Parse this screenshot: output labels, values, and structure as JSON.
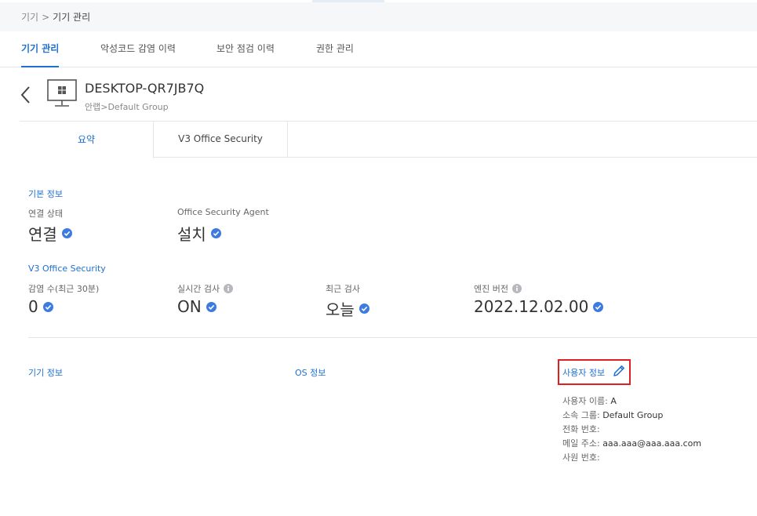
{
  "breadcrumb": {
    "root": "기기",
    "separator": ">",
    "current": "기기 관리"
  },
  "nav_tabs": [
    {
      "label": "기기 관리",
      "active": true
    },
    {
      "label": "악성코드 감염 이력",
      "active": false
    },
    {
      "label": "보안 점검 이력",
      "active": false
    },
    {
      "label": "권한 관리",
      "active": false
    }
  ],
  "device": {
    "name": "DESKTOP-QR7JB7Q",
    "group": "안랩>Default Group"
  },
  "sub_tabs": [
    {
      "label": "요약",
      "active": true
    },
    {
      "label": "V3 Office Security",
      "active": false
    }
  ],
  "basic_info": {
    "title": "기본 정보",
    "connection_label": "연결 상태",
    "connection_value": "연결",
    "agent_label": "Office Security Agent",
    "agent_value": "설치"
  },
  "v3": {
    "title": "V3 Office Security",
    "infection_label": "감염 수(최근 30분)",
    "infection_value": "0",
    "realtime_label": "실시간 검사",
    "realtime_value": "ON",
    "recent_label": "최근 검사",
    "recent_value": "오늘",
    "engine_label": "엔진 버전",
    "engine_value": "2022.12.02.00"
  },
  "details": {
    "device_info_title": "기기 정보",
    "os_info_title": "OS 정보",
    "user_info_title": "사용자 정보",
    "user_fields": [
      {
        "label": "사용자 이름:",
        "value": "A"
      },
      {
        "label": "소속 그룹:",
        "value": "Default Group"
      },
      {
        "label": "전화 번호:",
        "value": ""
      },
      {
        "label": "메일 주소:",
        "value": "aaa.aaa@aaa.aaa.com"
      },
      {
        "label": "사원 번호:",
        "value": ""
      }
    ]
  },
  "colors": {
    "accent": "#1f6fd1",
    "check": "#3d7be0",
    "highlight": "#e02020"
  }
}
